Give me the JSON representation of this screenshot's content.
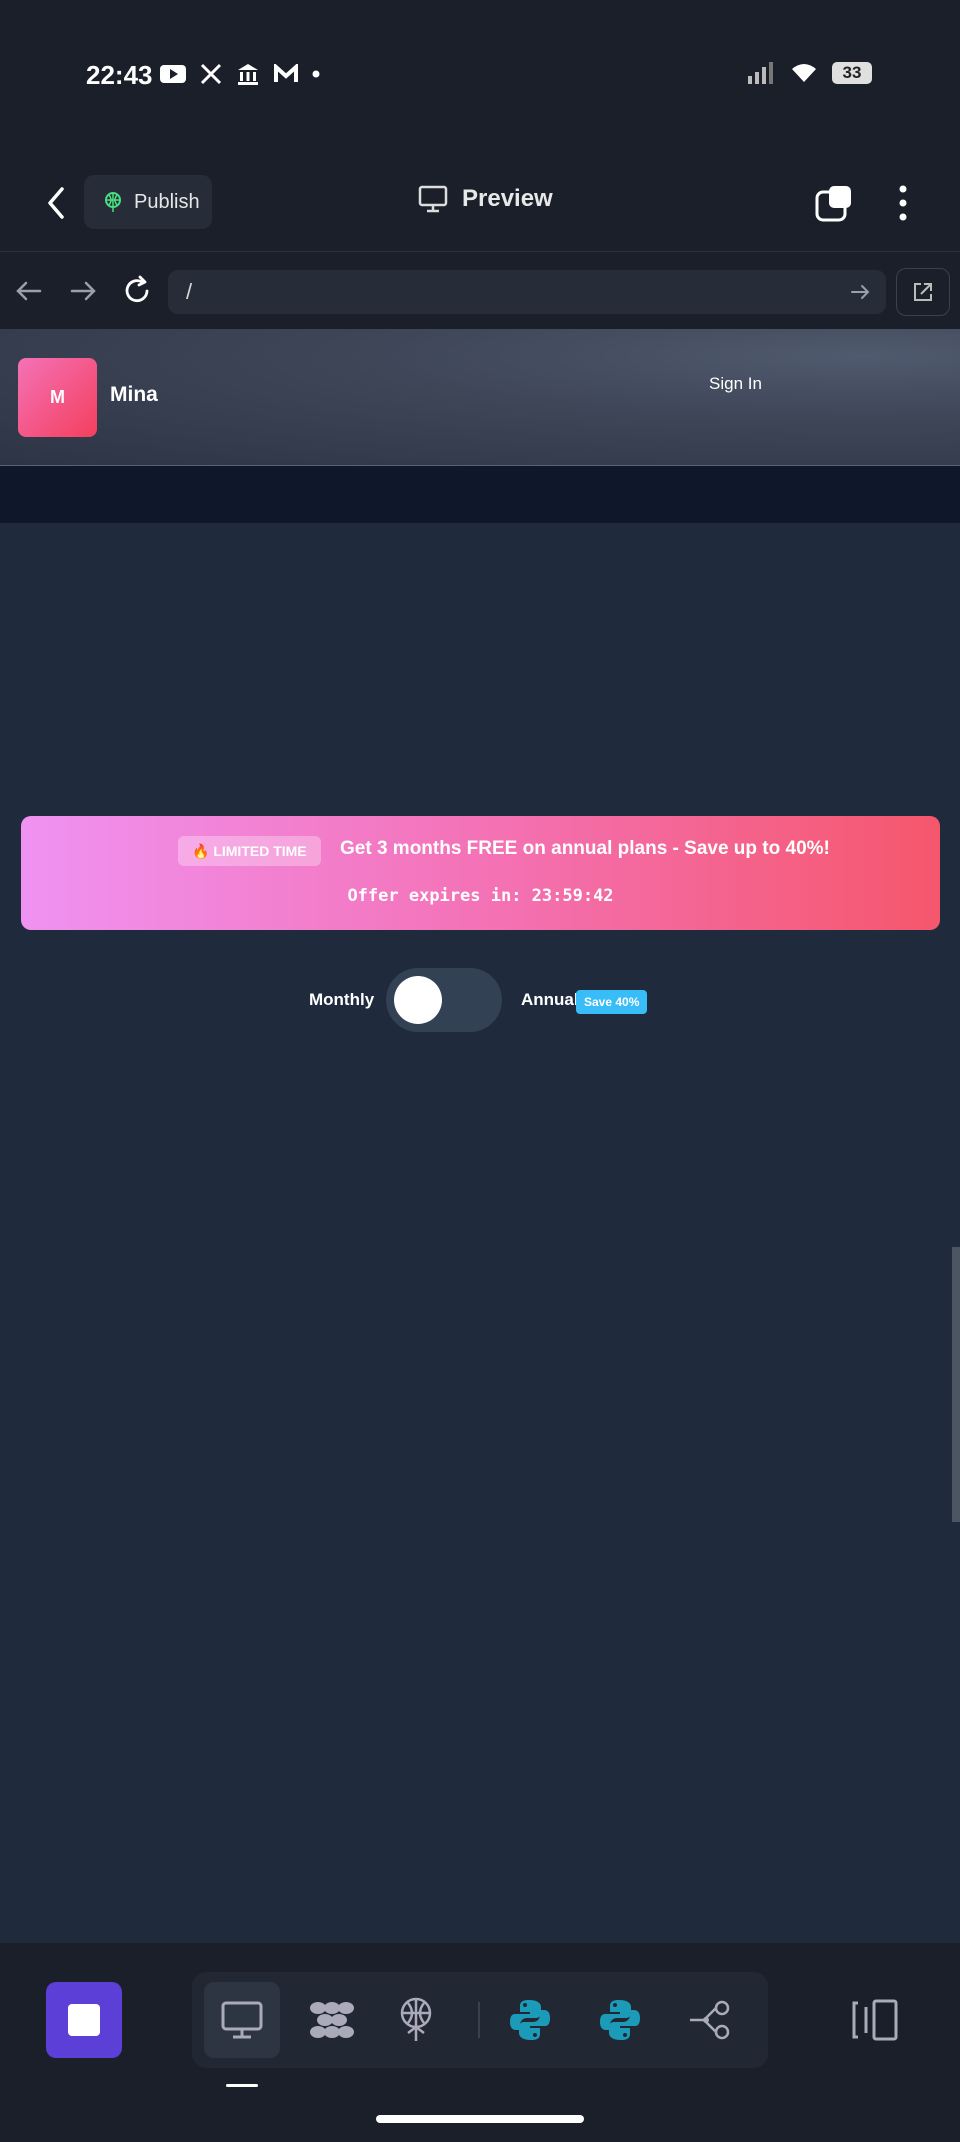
{
  "status_bar": {
    "time": "22:43",
    "battery": "33",
    "left_icons": [
      "youtube-icon",
      "x-icon",
      "bank-icon",
      "m-icon",
      "dot-icon"
    ],
    "right_icons": [
      "signal-icon",
      "wifi-icon",
      "battery-icon"
    ]
  },
  "app_header": {
    "publish_label": "Publish",
    "preview_label": "Preview"
  },
  "browser": {
    "url": "/"
  },
  "site": {
    "logo_letter": "M",
    "brand_name": "Mina",
    "signin_label": "Sign In"
  },
  "promo": {
    "badge": "🔥 LIMITED TIME",
    "headline": "Get 3 months FREE on annual plans - Save up to 40%!",
    "countdown": "Offer expires in: 23:59:42"
  },
  "billing": {
    "monthly_label": "Monthly",
    "annual_label": "Annual",
    "save_badge": "Save 40%",
    "annual_selected": false
  },
  "colors": {
    "accent_purple": "#5b3fd6",
    "promo_gradient_start": "#f092f2",
    "promo_gradient_end": "#f5576c",
    "save_badge": "#38bdf8",
    "page_background": "#1f2a3d"
  },
  "bottom_toolbar": {
    "tools": [
      "desktop-icon",
      "integrations-icon",
      "deploy-icon",
      "python-icon",
      "python-icon",
      "workflow-icon"
    ]
  }
}
